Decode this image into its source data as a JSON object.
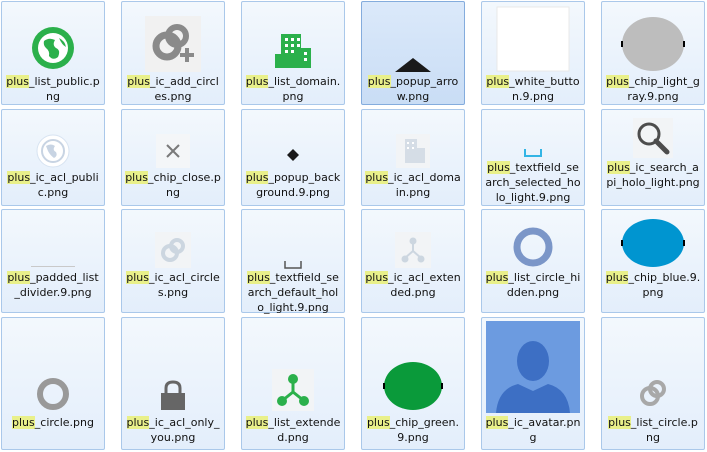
{
  "search_term": "plus",
  "colors": {
    "tile_bg": "#e6f0fb",
    "tile_border": "#aac8ea",
    "selected_bg": "#cfe0f6",
    "highlight": "#e9f08a",
    "green": "#2bb04b",
    "grey": "#8a8a8a",
    "blue": "#0095d0",
    "avatar_bg": "#6c9be0"
  },
  "items": [
    {
      "prefix": "plus",
      "rest": "_list_public.png",
      "icon": "globe-icon"
    },
    {
      "prefix": "plus",
      "rest": "_ic_add_circles.png",
      "icon": "add-circles-icon"
    },
    {
      "prefix": "plus",
      "rest": "_list_domain.png",
      "icon": "domain-icon"
    },
    {
      "prefix": "plus",
      "rest": "_popup_arrow.png",
      "icon": "popup-arrow-icon"
    },
    {
      "prefix": "plus",
      "rest": "_white_button.9.png",
      "icon": "white-button-icon"
    },
    {
      "prefix": "plus",
      "rest": "_chip_light_gray.9.png",
      "icon": "chip-light-gray-icon"
    },
    {
      "prefix": "plus",
      "rest": "_ic_acl_public.png",
      "icon": "acl-public-icon"
    },
    {
      "prefix": "plus",
      "rest": "_chip_close.png",
      "icon": "close-icon"
    },
    {
      "prefix": "plus",
      "rest": "_popup_background.9.png",
      "icon": "popup-background-icon"
    },
    {
      "prefix": "plus",
      "rest": "_ic_acl_domain.png",
      "icon": "acl-domain-icon"
    },
    {
      "prefix": "plus",
      "rest": "_textfield_search_selected_holo_light.9.png",
      "icon": "textfield-selected-icon"
    },
    {
      "prefix": "plus",
      "rest": "_ic_search_api_holo_light.png",
      "icon": "search-icon"
    },
    {
      "prefix": "plus",
      "rest": "_padded_list_divider.9.png",
      "icon": "divider-icon"
    },
    {
      "prefix": "plus",
      "rest": "_ic_acl_circles.png",
      "icon": "acl-circles-icon"
    },
    {
      "prefix": "plus",
      "rest": "_textfield_search_default_holo_light.9.png",
      "icon": "textfield-default-icon"
    },
    {
      "prefix": "plus",
      "rest": "_ic_acl_extended.png",
      "icon": "acl-extended-icon"
    },
    {
      "prefix": "plus",
      "rest": "_list_circle_hidden.png",
      "icon": "circle-hidden-icon"
    },
    {
      "prefix": "plus",
      "rest": "_chip_blue.9.png",
      "icon": "chip-blue-icon"
    },
    {
      "prefix": "plus",
      "rest": "_circle.png",
      "icon": "circle-icon"
    },
    {
      "prefix": "plus",
      "rest": "_ic_acl_only_you.png",
      "icon": "lock-icon"
    },
    {
      "prefix": "plus",
      "rest": "_list_extended.png",
      "icon": "extended-icon"
    },
    {
      "prefix": "plus",
      "rest": "_chip_green.9.png",
      "icon": "chip-green-icon"
    },
    {
      "prefix": "plus",
      "rest": "_ic_avatar.png",
      "icon": "avatar-icon"
    },
    {
      "prefix": "plus",
      "rest": "_list_circle.png",
      "icon": "list-circle-icon"
    }
  ]
}
